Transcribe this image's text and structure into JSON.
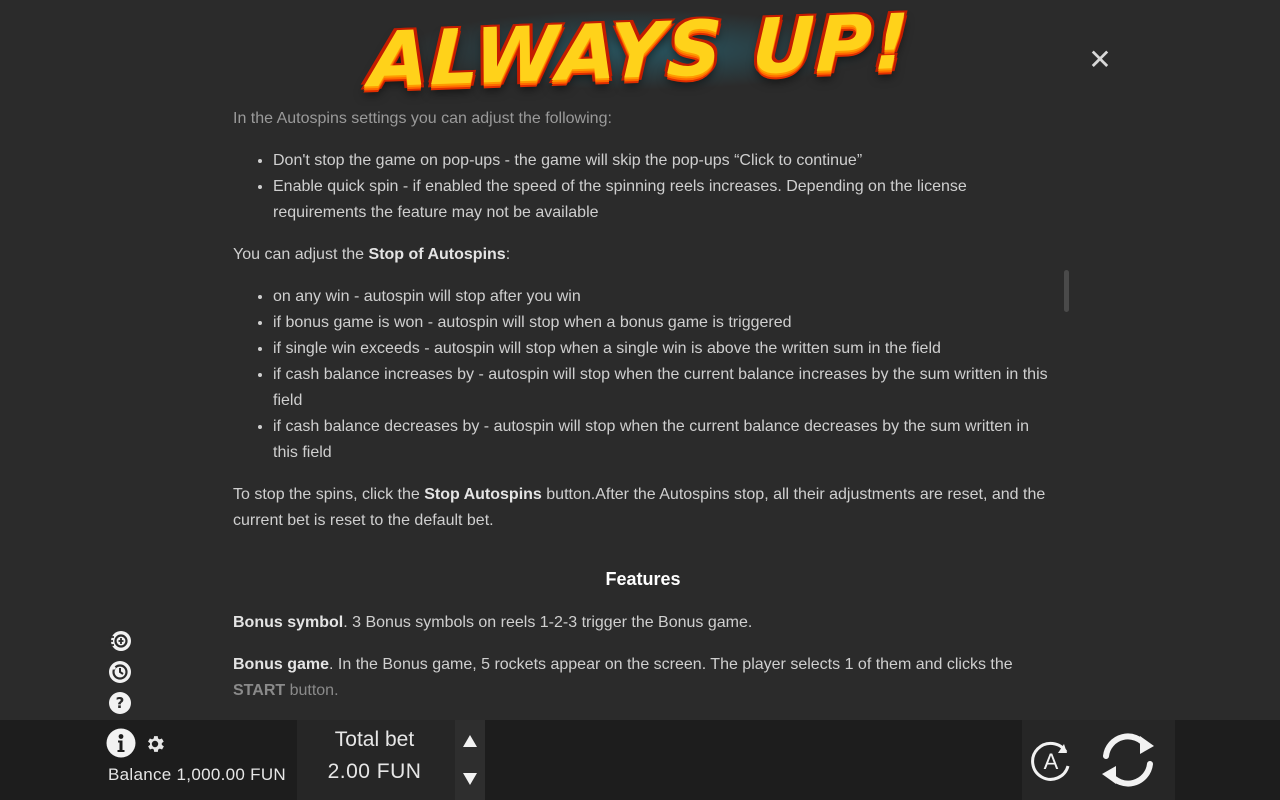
{
  "logo": {
    "text": "ALWAYS UP!"
  },
  "close": {
    "glyph": "✕"
  },
  "content": {
    "intro": "In the Autospins settings you can adjust the following:",
    "settings_list": [
      "Don't stop the game on pop-ups - the game will skip the pop-ups “Click to continue”",
      "Enable quick spin - if enabled the speed of the spinning reels increases. Depending on the license requirements the feature may not be available"
    ],
    "stop_intro_pre": "You can adjust the ",
    "stop_intro_bold": "Stop of Autospins",
    "stop_intro_post": ":",
    "stop_list": [
      "on any win - autospin will stop after you win",
      "if bonus game is won - autospin will stop when a bonus game is triggered",
      "if single win exceeds - autospin will stop when a single win is above the written sum in the field",
      "if cash balance increases by - autospin will stop when the current balance increases by the sum written in this field",
      "if cash balance decreases by - autospin will stop when the current balance decreases by the sum written in this field"
    ],
    "stop_para_pre": "To stop the spins, click the ",
    "stop_para_bold": "Stop Autospins",
    "stop_para_post": " button.After the Autospins stop, all their adjustments are reset, and the current bet is reset to the default bet.",
    "features_title": "Features",
    "bonus_symbol_bold": "Bonus symbol",
    "bonus_symbol_text": ". 3 Bonus symbols on reels 1-2-3 trigger the Bonus game.",
    "bonus_game_bold": "Bonus game",
    "bonus_game_text": ". In the Bonus game, 5 rockets appear on the screen. The player selects 1 of them and clicks the ",
    "bonus_game_bold2": "START",
    "bonus_game_text2": " button."
  },
  "bottom": {
    "balance": "Balance 1,000.00 FUN",
    "total_bet_label": "Total bet",
    "total_bet_value": "2.00 FUN",
    "auto_letter": "A"
  },
  "icons": {
    "side": [
      "coin-speed-icon",
      "history-icon",
      "help-icon"
    ],
    "info": "info-icon",
    "settings": "gear-icon",
    "autoplay": "autoplay-icon",
    "spin": "spin-icon"
  },
  "colors": {
    "background": "#2b2b2b",
    "bar": "#1d1d1d",
    "text": "#cfcfcf",
    "logo_yellow": "#ffd21a",
    "logo_red": "#c41c00"
  }
}
